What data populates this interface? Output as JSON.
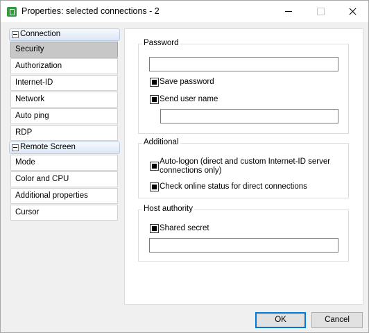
{
  "window": {
    "title": "Properties: selected connections - 2"
  },
  "nav": {
    "groups": [
      {
        "label": "Connection",
        "items": [
          "Security",
          "Authorization",
          "Internet-ID",
          "Network",
          "Auto ping",
          "RDP"
        ]
      },
      {
        "label": "Remote Screen",
        "items": [
          "Mode",
          "Color and CPU",
          "Additional properties",
          "Cursor"
        ]
      }
    ],
    "selected": "Security"
  },
  "password_group": {
    "title": "Password",
    "password_value": "",
    "save_password": {
      "label": "Save password",
      "checked": true
    },
    "send_user_name": {
      "label": "Send user name",
      "checked": true
    },
    "user_name_value": ""
  },
  "additional_group": {
    "title": "Additional",
    "auto_logon": {
      "label_line1": "Auto-logon (direct and custom Internet-ID server",
      "label_line2": "connections only)",
      "checked": true
    },
    "check_online": {
      "label": "Check online status for direct connections",
      "checked": true
    }
  },
  "host_group": {
    "title": "Host authority",
    "shared_secret": {
      "label": "Shared secret",
      "checked": true
    },
    "shared_secret_value": ""
  },
  "buttons": {
    "ok": "OK",
    "cancel": "Cancel"
  },
  "colors": {
    "accent": "#0078d7",
    "selected_item": "#c7c7c7",
    "group_header": "#dce7f5"
  }
}
